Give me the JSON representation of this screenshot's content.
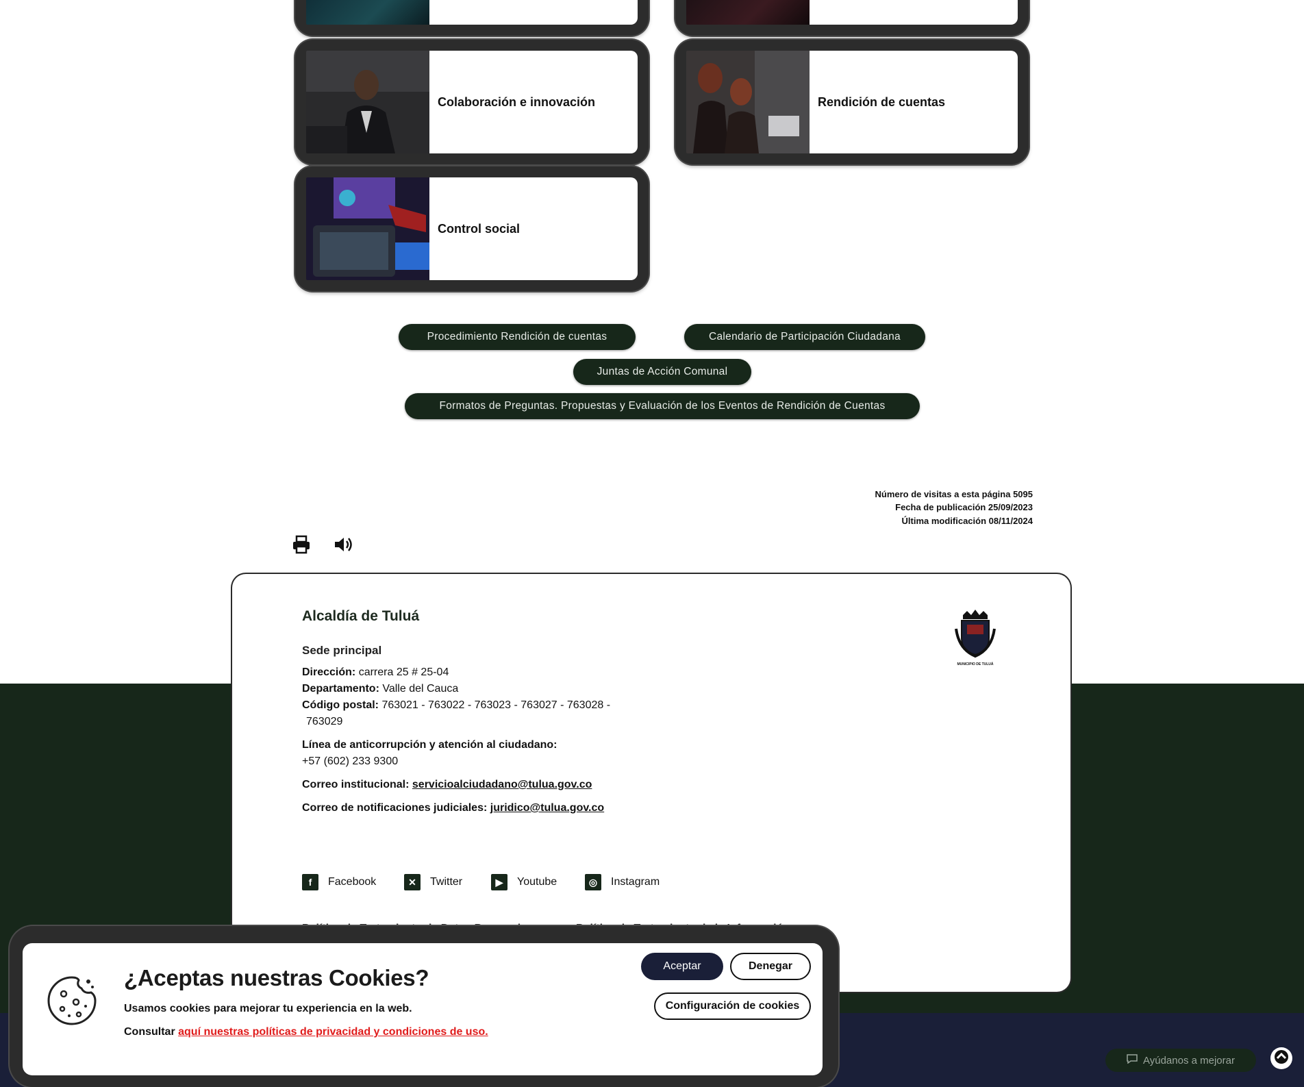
{
  "cards": [
    {
      "label": ""
    },
    {
      "label": ""
    },
    {
      "label": "Colaboración e innovación"
    },
    {
      "label": "Rendición de cuentas"
    },
    {
      "label": "Control social"
    }
  ],
  "links": {
    "procedimiento": "Procedimiento Rendición de cuentas",
    "calendario": "Calendario de Participación Ciudadana",
    "juntas": "Juntas de Acción Comunal",
    "formatos": "Formatos de Preguntas. Propuestas y Evaluación de los Eventos de Rendición de Cuentas"
  },
  "page_meta": {
    "visits": "Número de visitas a esta página 5095",
    "published": "Fecha de publicación 25/09/2023",
    "modified": "Última modificación 08/11/2024"
  },
  "tools": {
    "print_icon": "print-icon",
    "audio_icon": "speaker-icon"
  },
  "footer": {
    "title": "Alcaldía de Tuluá",
    "subtitle": "Sede principal",
    "direccion_label": "Dirección:",
    "direccion_value": "carrera 25 # 25-04",
    "departamento_label": "Departamento:",
    "departamento_value": "Valle del Cauca",
    "postal_label": "Código postal:",
    "postal_value": "763021 - 763022 - 763023 - 763027 - 763028 -",
    "postal_value_2": "763029",
    "linea_label": "Línea de anticorrupción y atención al ciudadano:",
    "linea_value": "+57 (602) 233 9300",
    "correo_label": "Correo institucional:",
    "correo_value": "servicioalciudadano@tulua.gov.co",
    "judicial_label": "Correo de notificaciones judiciales:",
    "judicial_value": "juridico@tulua.gov.co",
    "logo_caption": "MUNICIPIO DE TULUÁ",
    "social": [
      {
        "label": "Facebook",
        "icon": "facebook-icon"
      },
      {
        "label": "Twitter",
        "icon": "x-twitter-icon"
      },
      {
        "label": "Youtube",
        "icon": "youtube-icon"
      },
      {
        "label": "Instagram",
        "icon": "instagram-icon"
      }
    ],
    "policy_1": "Política de Tratamiento de Datos Personales",
    "policy_2": "Política de Tratamiento de la Información"
  },
  "cookie": {
    "title": "¿Aceptas nuestras Cookies?",
    "text": "Usamos cookies para mejorar tu experiencia en la web.",
    "consult_prefix": "Consultar",
    "consult_link": "aquí nuestras políticas de privacidad y condiciones de uso.",
    "accept": "Aceptar",
    "deny": "Denegar",
    "config": "Configuración de cookies"
  },
  "feedback": {
    "label": "Ayúdanos a mejorar"
  }
}
